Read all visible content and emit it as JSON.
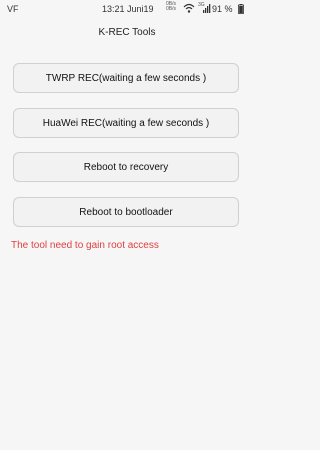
{
  "status_bar": {
    "carrier": "VF",
    "time": "13:21 Juni19",
    "net_speed": "0B/s",
    "net_speed2": "0B/s",
    "net_type": "3G",
    "battery_text": "91 %"
  },
  "app": {
    "title": "K-REC Tools"
  },
  "buttons": [
    {
      "label": "TWRP REC(waiting a few seconds )"
    },
    {
      "label": "HuaWei REC(waiting a few seconds )"
    },
    {
      "label": "Reboot to recovery"
    },
    {
      "label": "Reboot to bootloader"
    }
  ],
  "warning": "The tool need to gain root access",
  "colors": {
    "warning": "#e04040",
    "background": "#f6f6f6"
  },
  "icons": [
    "wifi-icon",
    "signal-icon",
    "battery-icon"
  ]
}
